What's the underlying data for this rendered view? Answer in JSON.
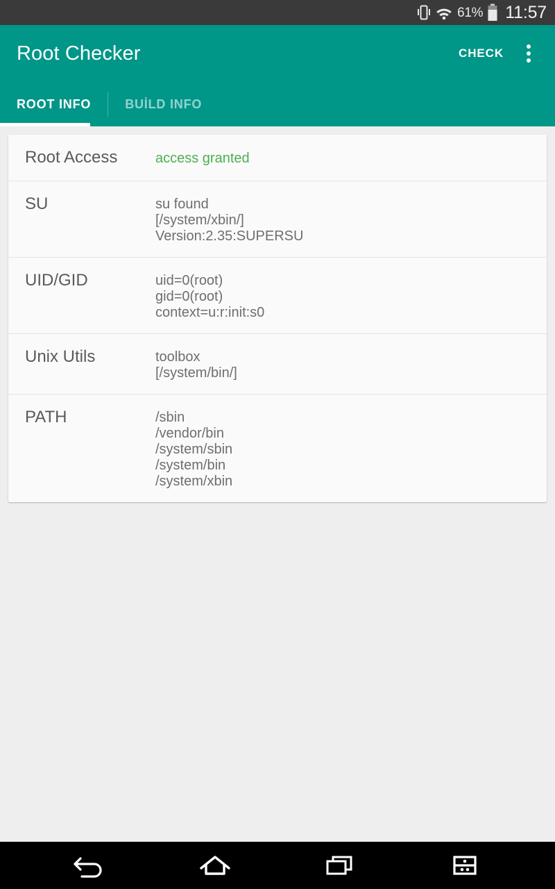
{
  "status_bar": {
    "vibrate_icon": "vibrate-icon",
    "wifi_icon": "wifi-icon",
    "battery_percent": "61%",
    "battery_icon": "battery-icon",
    "clock": "11:57",
    "background_color": "#3a3a3a"
  },
  "appbar": {
    "title": "Root Checker",
    "check_label": "CHECK",
    "overflow_icon": "overflow-menu-icon",
    "accent_color": "#009688"
  },
  "tabs": [
    {
      "label": "ROOT INFO",
      "active": true
    },
    {
      "label": "BUİLD INFO",
      "active": false
    }
  ],
  "rows": [
    {
      "label": "Root Access",
      "value": "access granted",
      "state": "granted",
      "state_color": "#4caf50"
    },
    {
      "label": "SU",
      "value": "su found\n[/system/xbin/]\nVersion:2.35:SUPERSU",
      "state": "normal"
    },
    {
      "label": "UID/GID",
      "value": "uid=0(root)\ngid=0(root)\ncontext=u:r:init:s0",
      "state": "normal"
    },
    {
      "label": "Unix Utils",
      "value": "toolbox\n[/system/bin/]",
      "state": "normal"
    },
    {
      "label": "PATH",
      "value": "/sbin\n/vendor/bin\n/system/sbin\n/system/bin\n/system/xbin",
      "state": "normal"
    }
  ],
  "navbar": {
    "back_icon": "back-icon",
    "home_icon": "home-icon",
    "recents_icon": "recent-apps-icon",
    "split_screen_icon": "split-screen-icon"
  }
}
